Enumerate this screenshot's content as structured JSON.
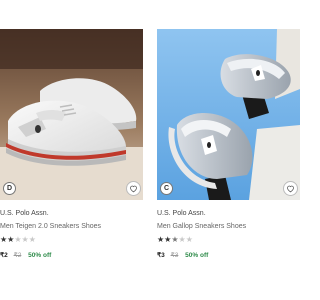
{
  "products": [
    {
      "badge_icon": "d-circle-icon",
      "badge_letter": "D",
      "wishlist_icon": "heart-outline-icon",
      "brand": "U.S. Polo Assn.",
      "title": "Men Teigen 2.0 Sneakers Shoes",
      "rating_stars": 2,
      "rating_max": 5,
      "price": "₹2",
      "mrp": "₹2",
      "discount": "50% off"
    },
    {
      "badge_icon": "c-circle-icon",
      "badge_letter": "C",
      "wishlist_icon": "heart-outline-icon",
      "brand": "U.S. Polo Assn.",
      "title": "Men Gallop Sneakers Shoes",
      "rating_stars": 2.5,
      "rating_max": 5,
      "price": "₹3",
      "mrp": "₹3",
      "discount": "50% off"
    }
  ]
}
